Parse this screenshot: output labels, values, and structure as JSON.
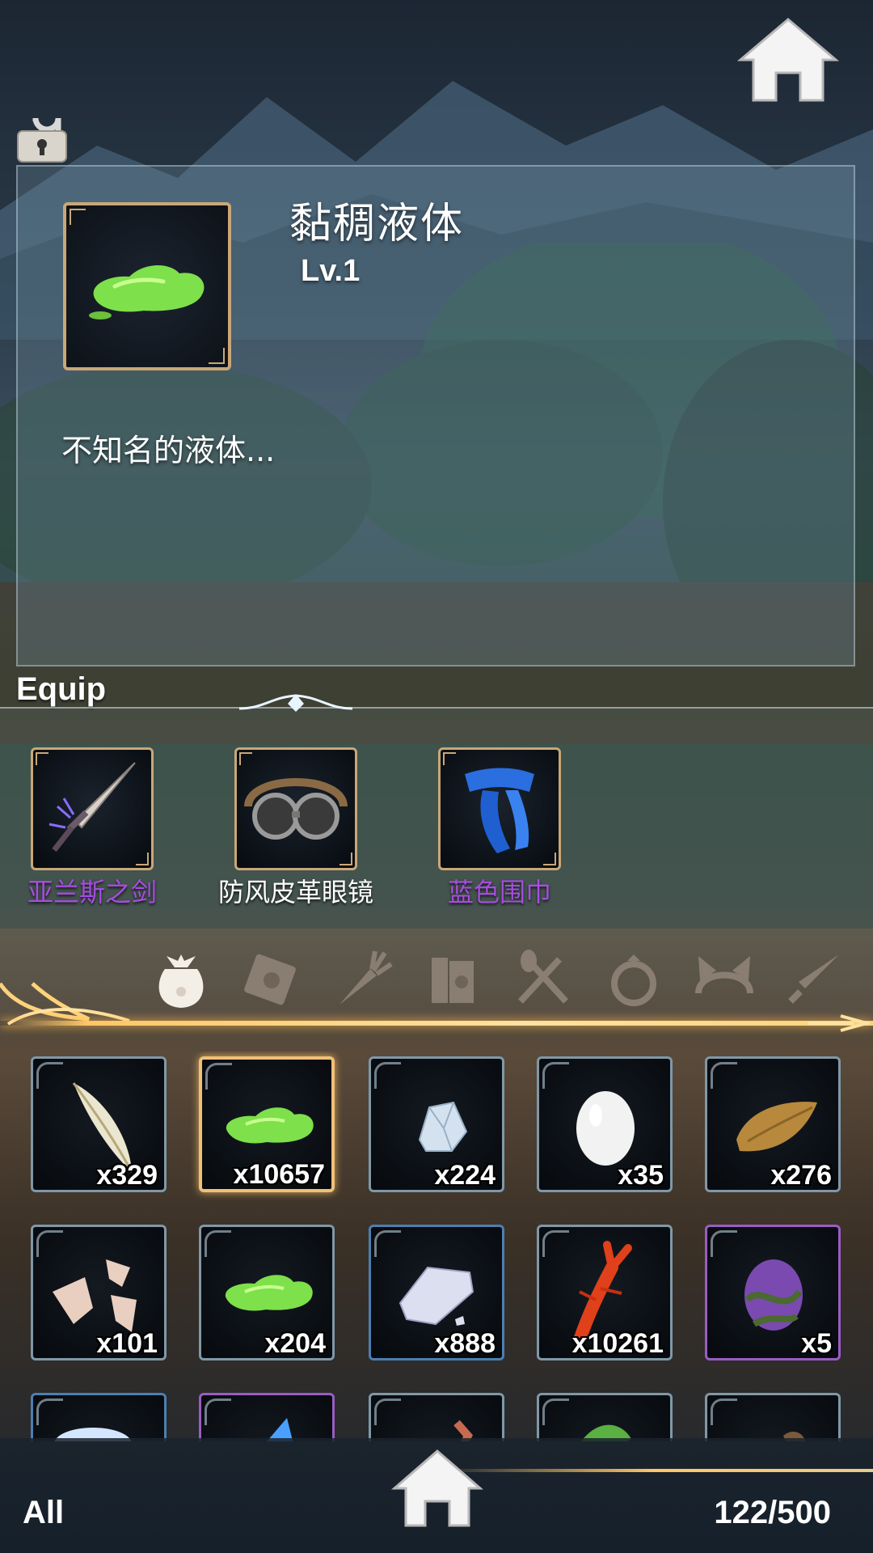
{
  "colors": {
    "accent_gold": "#c9a777",
    "rare_purple": "#a64de0",
    "selected_glow": "#f0c078"
  },
  "detail": {
    "name": "黏稠液体",
    "level": "Lv.1",
    "description": "不知名的液体..."
  },
  "equip": {
    "title": "Equip",
    "items": [
      {
        "name": "亚兰斯之剑",
        "icon": "sword-icon",
        "rarity_color": "#a64de0"
      },
      {
        "name": "防风皮革眼镜",
        "icon": "goggles-icon",
        "rarity_color": "#ffffff"
      },
      {
        "name": "蓝色围巾",
        "icon": "scarf-icon",
        "rarity_color": "#a64de0"
      }
    ]
  },
  "tabs": [
    {
      "id": "bag",
      "icon": "bag-icon",
      "active": true
    },
    {
      "id": "scroll",
      "icon": "scroll-icon",
      "active": false
    },
    {
      "id": "vegetable",
      "icon": "carrot-icon",
      "active": false
    },
    {
      "id": "book",
      "icon": "book-icon",
      "active": false
    },
    {
      "id": "cooking",
      "icon": "utensils-icon",
      "active": false
    },
    {
      "id": "ring",
      "icon": "ring-icon",
      "active": false
    },
    {
      "id": "headwear",
      "icon": "cat-ears-icon",
      "active": false
    },
    {
      "id": "weapon",
      "icon": "sword-tab-icon",
      "active": false
    }
  ],
  "inventory": {
    "rows": [
      [
        {
          "icon": "feather-icon",
          "count": "x329",
          "rarity": "normal"
        },
        {
          "icon": "slime-icon",
          "count": "x10657",
          "rarity": "normal",
          "selected": true
        },
        {
          "icon": "crystal-ore-icon",
          "count": "x224",
          "rarity": "normal"
        },
        {
          "icon": "egg-icon",
          "count": "x35",
          "rarity": "normal"
        },
        {
          "icon": "fur-icon",
          "count": "x276",
          "rarity": "normal"
        }
      ],
      [
        {
          "icon": "shell-fragments-icon",
          "count": "x101",
          "rarity": "normal"
        },
        {
          "icon": "slime-icon",
          "count": "x204",
          "rarity": "normal"
        },
        {
          "icon": "silver-ore-icon",
          "count": "x888",
          "rarity": "blue"
        },
        {
          "icon": "crayfish-icon",
          "count": "x10261",
          "rarity": "normal"
        },
        {
          "icon": "vine-egg-icon",
          "count": "x5",
          "rarity": "purple"
        }
      ],
      [
        {
          "icon": "blue-gem-icon",
          "count": "",
          "rarity": "blue"
        },
        {
          "icon": "blue-crystal-icon",
          "count": "",
          "rarity": "purple"
        },
        {
          "icon": "red-item-icon",
          "count": "",
          "rarity": "normal"
        },
        {
          "icon": "green-leaf-icon",
          "count": "",
          "rarity": "normal"
        },
        {
          "icon": "brown-item-icon",
          "count": "",
          "rarity": "normal"
        }
      ]
    ]
  },
  "footer": {
    "filter_label": "All",
    "capacity": "122/500"
  }
}
